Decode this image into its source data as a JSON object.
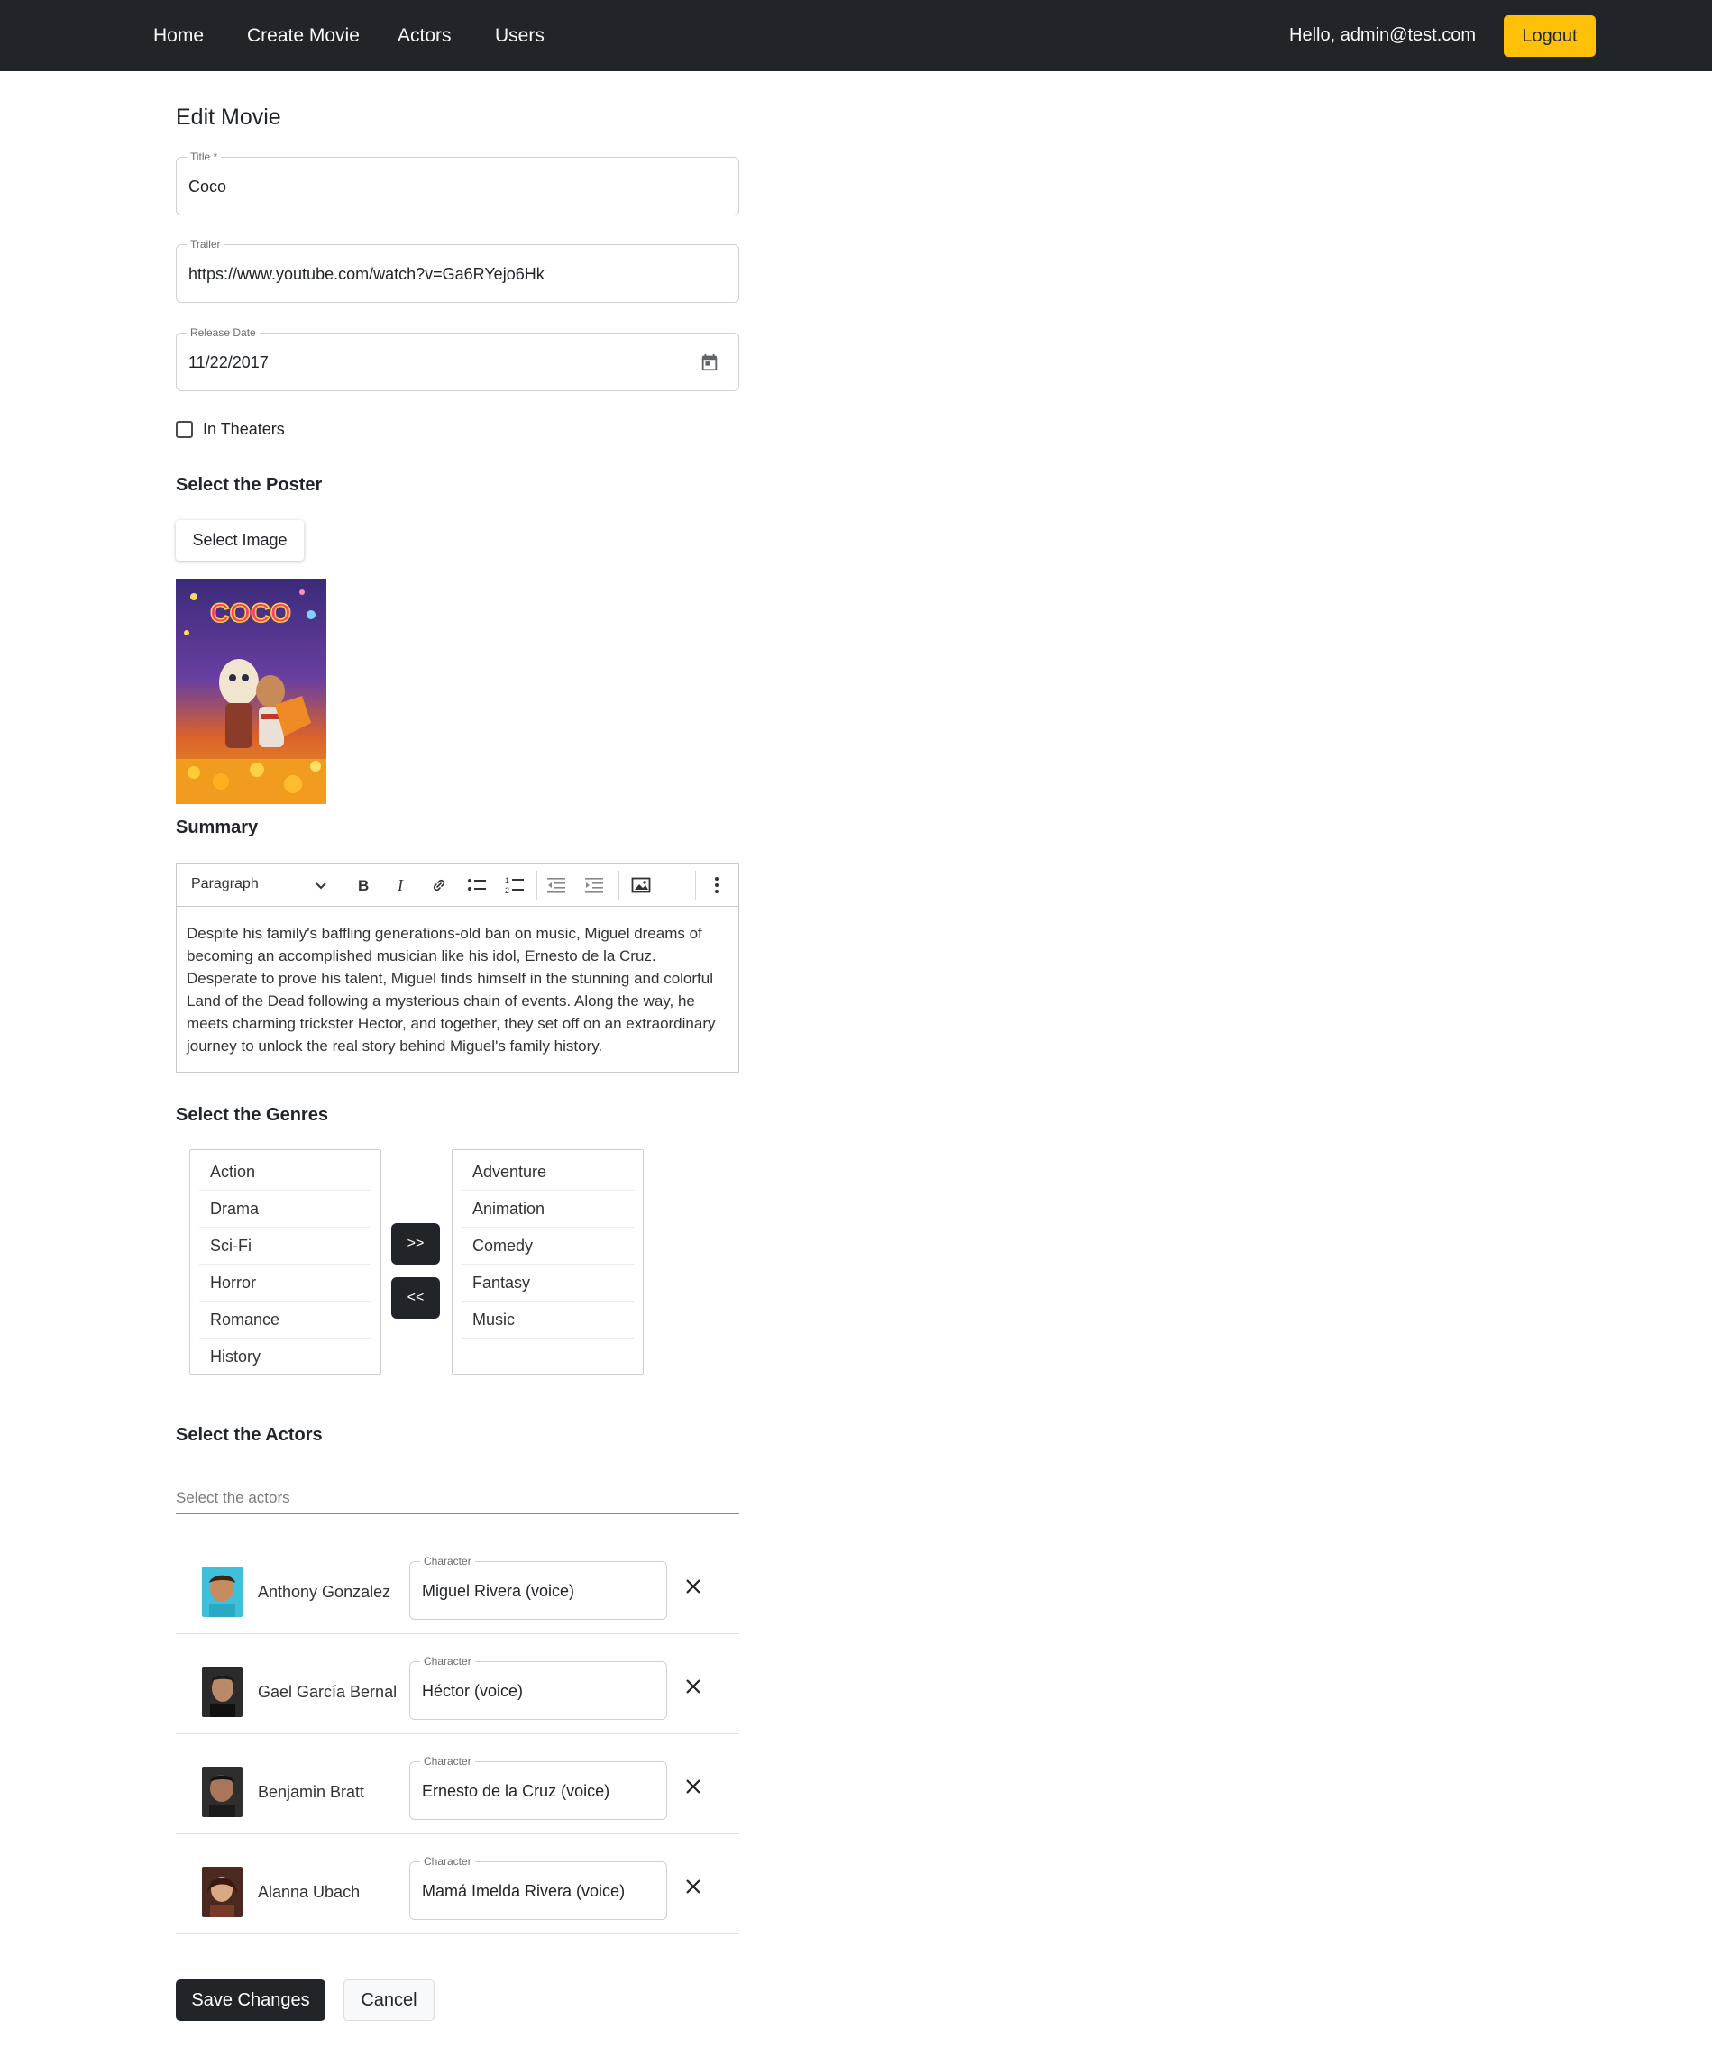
{
  "nav": {
    "links": [
      "Home",
      "Create Movie",
      "Actors",
      "Users"
    ],
    "greeting": "Hello, admin@test.com",
    "logout_label": "Logout"
  },
  "page": {
    "title": "Edit Movie"
  },
  "form": {
    "title": {
      "label": "Title *",
      "value": "Coco"
    },
    "trailer": {
      "label": "Trailer",
      "value": "https://www.youtube.com/watch?v=Ga6RYejo6Hk"
    },
    "release_date": {
      "label": "Release Date",
      "value": "11/22/2017"
    },
    "in_theaters": {
      "label": "In Theaters",
      "checked": false
    }
  },
  "poster": {
    "section_title": "Select the Poster",
    "button_label": "Select Image",
    "poster_title": "COCO"
  },
  "summary": {
    "section_title": "Summary",
    "block_style": "Paragraph",
    "text": "Despite his family's baffling generations-old ban on music, Miguel dreams of becoming an accomplished musician like his idol, Ernesto de la Cruz. Desperate to prove his talent, Miguel finds himself in the stunning and colorful Land of the Dead following a mysterious chain of events. Along the way, he meets charming trickster Hector, and together, they set off on an extraordinary journey to unlock the real story behind Miguel's family history.",
    "toolbar_icons": [
      "bold-icon",
      "italic-icon",
      "link-icon",
      "bulleted-list-icon",
      "numbered-list-icon",
      "outdent-icon",
      "indent-icon",
      "image-icon",
      "more-icon"
    ]
  },
  "genres": {
    "section_title": "Select the Genres",
    "available": [
      "Action",
      "Drama",
      "Sci-Fi",
      "Horror",
      "Romance",
      "History"
    ],
    "selected": [
      "Adventure",
      "Animation",
      "Comedy",
      "Fantasy",
      "Music"
    ],
    "add_label": ">>",
    "remove_label": "<<"
  },
  "actors": {
    "section_title": "Select the Actors",
    "search_placeholder": "Select the actors",
    "character_label": "Character",
    "list": [
      {
        "name": "Anthony Gonzalez",
        "character": "Miguel Rivera (voice)"
      },
      {
        "name": "Gael García Bernal",
        "character": "Héctor (voice)"
      },
      {
        "name": "Benjamin Bratt",
        "character": "Ernesto de la Cruz (voice)"
      },
      {
        "name": "Alanna Ubach",
        "character": "Mamá Imelda Rivera (voice)"
      }
    ]
  },
  "actions": {
    "save_label": "Save Changes",
    "cancel_label": "Cancel"
  },
  "colors": {
    "navbar": "#212529",
    "accent": "#ffc107",
    "dark_button": "#212529"
  }
}
